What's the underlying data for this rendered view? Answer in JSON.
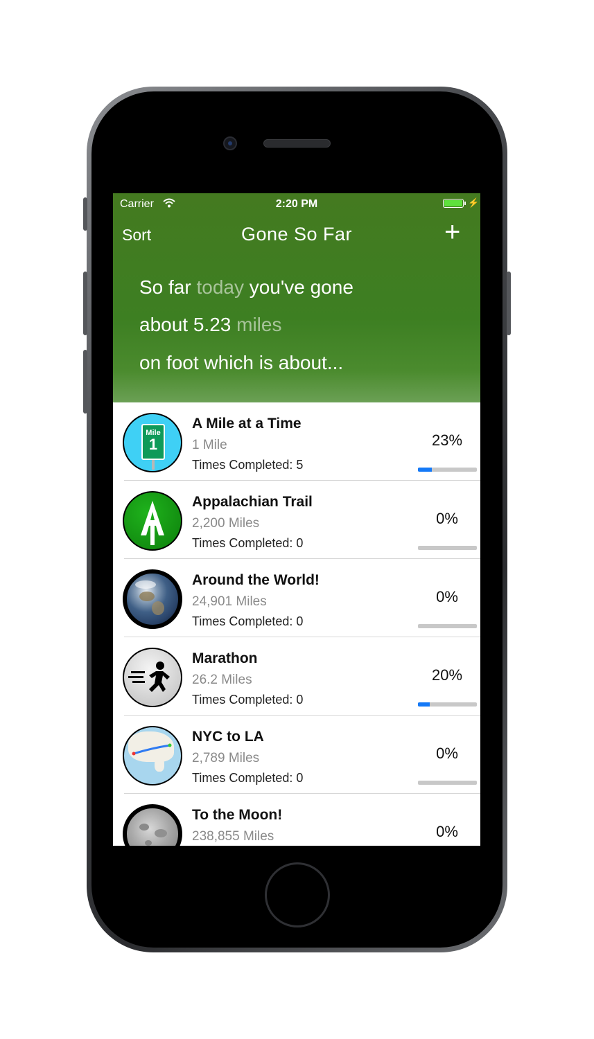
{
  "status": {
    "carrier": "Carrier",
    "time": "2:20 PM"
  },
  "nav": {
    "sort_label": "Sort",
    "title": "Gone So Far",
    "add_label": "+"
  },
  "summary": {
    "part1": "So far ",
    "period": "today",
    "part2": " you've gone",
    "part3": "about 5.23 ",
    "unit": "miles",
    "part4": "on foot which is about..."
  },
  "goals": [
    {
      "name": "A Mile at a Time",
      "distance": "1 Mile",
      "times": "Times Completed: 5",
      "percent": "23%",
      "progress": 0.23,
      "icon": "mile-sign-icon",
      "icon_text": "Mile",
      "icon_num": "1"
    },
    {
      "name": "Appalachian Trail",
      "distance": "2,200 Miles",
      "times": "Times Completed: 0",
      "percent": "0%",
      "progress": 0,
      "icon": "appalachian-trail-icon",
      "icon_text": "A"
    },
    {
      "name": "Around the World!",
      "distance": "24,901 Miles",
      "times": "Times Completed: 0",
      "percent": "0%",
      "progress": 0,
      "icon": "earth-icon"
    },
    {
      "name": "Marathon",
      "distance": "26.2 Miles",
      "times": "Times Completed: 0",
      "percent": "20%",
      "progress": 0.2,
      "icon": "runner-icon"
    },
    {
      "name": "NYC to LA",
      "distance": "2,789 Miles",
      "times": "Times Completed: 0",
      "percent": "0%",
      "progress": 0,
      "icon": "map-icon"
    },
    {
      "name": "To the Moon!",
      "distance": "238,855 Miles",
      "times": "",
      "percent": "0%",
      "progress": 0,
      "icon": "moon-icon"
    }
  ],
  "colors": {
    "header_green": "#447a20",
    "progress_blue": "#1479f7",
    "mile_sign_green": "#0f9a59",
    "icon_sky": "#3fd0f5"
  }
}
